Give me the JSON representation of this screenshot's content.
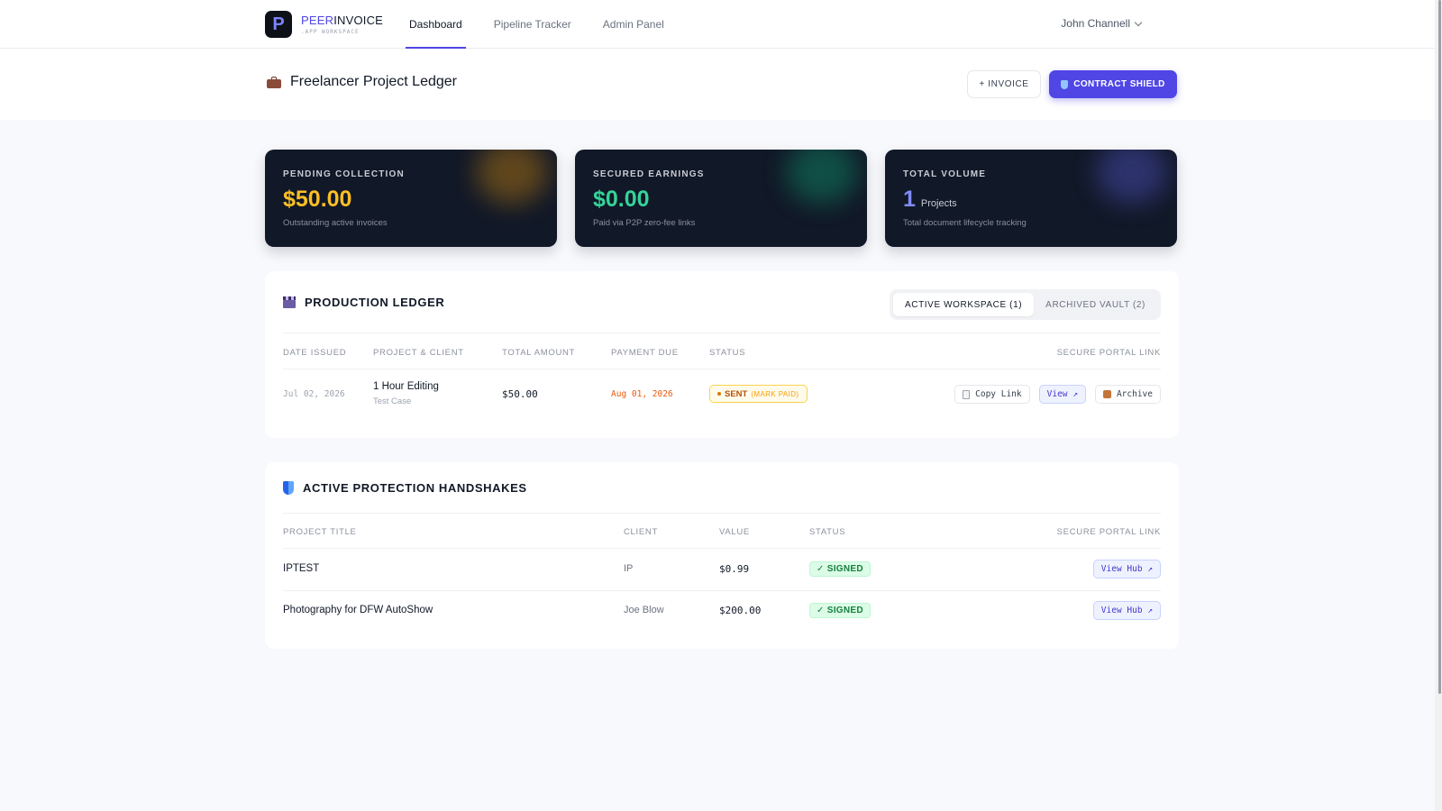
{
  "brand": {
    "name_accent": "PEER",
    "name_rest": "INVOICE",
    "subtitle": ".APP WORKSPACE",
    "logo_letter": "P"
  },
  "nav": {
    "links": [
      {
        "label": "Dashboard",
        "active": true
      },
      {
        "label": "Pipeline Tracker",
        "active": false
      },
      {
        "label": "Admin Panel",
        "active": false
      }
    ],
    "user": "John Channell"
  },
  "page": {
    "title": "Freelancer Project Ledger",
    "icon": "briefcase-icon",
    "invoice_button": "+ INVOICE",
    "shield_button": "CONTRACT SHIELD"
  },
  "stats": {
    "pending": {
      "label": "PENDING COLLECTION",
      "value": "$50.00",
      "sub": "Outstanding active invoices",
      "color": "#fbbf24"
    },
    "secured": {
      "label": "SECURED EARNINGS",
      "value": "$0.00",
      "sub": "Paid via P2P zero-fee links",
      "color": "#34d399"
    },
    "volume": {
      "label": "TOTAL VOLUME",
      "value": "1",
      "unit": "Projects",
      "sub": "Total document lifecycle tracking",
      "color": "#818cf8"
    }
  },
  "ledger": {
    "title": "PRODUCTION LEDGER",
    "icon": "clapperboard-icon",
    "tabs": [
      {
        "label": "ACTIVE WORKSPACE (1)",
        "active": true
      },
      {
        "label": "ARCHIVED VAULT (2)",
        "active": false
      }
    ],
    "columns": [
      "DATE ISSUED",
      "PROJECT & CLIENT",
      "TOTAL AMOUNT",
      "PAYMENT DUE",
      "STATUS",
      "SECURE PORTAL LINK"
    ],
    "rows": [
      {
        "date": "Jul 02, 2026",
        "project": "1 Hour Editing",
        "client": "Test Case",
        "amount": "$50.00",
        "due": "Aug 01, 2026",
        "status": "SENT",
        "status_action": "(MARK PAID)",
        "actions": {
          "copy": "Copy Link",
          "view": "View ↗",
          "archive": "Archive"
        }
      }
    ]
  },
  "handshakes": {
    "title": "ACTIVE PROTECTION HANDSHAKES",
    "icon": "shield-icon",
    "columns": [
      "PROJECT TITLE",
      "CLIENT",
      "VALUE",
      "STATUS",
      "SECURE PORTAL LINK"
    ],
    "rows": [
      {
        "title": "IPTEST",
        "client": "IP",
        "value": "$0.99",
        "status": "✓ SIGNED",
        "link": "View Hub ↗"
      },
      {
        "title": "Photography for DFW AutoShow",
        "client": "Joe Blow",
        "value": "$200.00",
        "status": "✓ SIGNED",
        "link": "View Hub ↗"
      }
    ]
  },
  "colors": {
    "accent": "#4f46e5",
    "card_bg": "#111827",
    "due_date": "#ea580c"
  }
}
